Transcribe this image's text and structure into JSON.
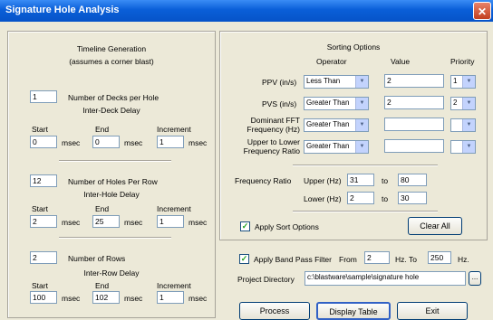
{
  "window": {
    "title": "Signature Hole Analysis",
    "close_glyph": "✕"
  },
  "timeline": {
    "header": "Timeline Generation",
    "subheader": "(assumes a corner blast)",
    "decks": {
      "value": "1",
      "label": "Number of Decks per Hole"
    },
    "inter_deck": {
      "title": "Inter-Deck Delay",
      "start": "0",
      "end": "0",
      "increment": "1"
    },
    "holes": {
      "value": "12",
      "label": "Number of Holes Per Row"
    },
    "inter_hole": {
      "title": "Inter-Hole Delay",
      "start": "2",
      "end": "25",
      "increment": "1"
    },
    "rows": {
      "value": "2",
      "label": "Number of Rows"
    },
    "inter_row": {
      "title": "Inter-Row Delay",
      "start": "100",
      "end": "102",
      "increment": "1"
    },
    "col_start": "Start",
    "col_end": "End",
    "col_increment": "Increment",
    "unit": "msec"
  },
  "sorting": {
    "header": "Sorting Options",
    "col_operator": "Operator",
    "col_value": "Value",
    "col_priority": "Priority",
    "rows": [
      {
        "label": "PPV (in/s)",
        "operator": "Less Than",
        "value": "2",
        "priority": "1"
      },
      {
        "label": "PVS (in/s)",
        "operator": "Greater Than",
        "value": "2",
        "priority": "2"
      },
      {
        "label1": "Dominant FFT",
        "label2": "Frequency (Hz)",
        "operator": "Greater Than",
        "value": "",
        "priority": ""
      },
      {
        "label1": "Upper to Lower",
        "label2": "Frequency Ratio",
        "operator": "Greater Than",
        "value": "",
        "priority": ""
      }
    ],
    "freq_ratio": {
      "label": "Frequency Ratio",
      "upper_label": "Upper (Hz)",
      "upper_from": "31",
      "upper_to": "80",
      "lower_label": "Lower (Hz)",
      "lower_from": "2",
      "lower_to": "30",
      "to": "to"
    },
    "apply_label": "Apply Sort Options",
    "apply_checked": true,
    "clear_label": "Clear All"
  },
  "bandpass": {
    "label": "Apply Band Pass Filter",
    "checked": true,
    "from_label": "From",
    "from": "2",
    "hz_to": "Hz. To",
    "to": "250",
    "hz": "Hz."
  },
  "project": {
    "label": "Project Directory",
    "path": "c:\\blastware\\sample\\signature hole",
    "browse": "..."
  },
  "buttons": {
    "process": "Process",
    "display_table": "Display Table",
    "exit": "Exit"
  }
}
